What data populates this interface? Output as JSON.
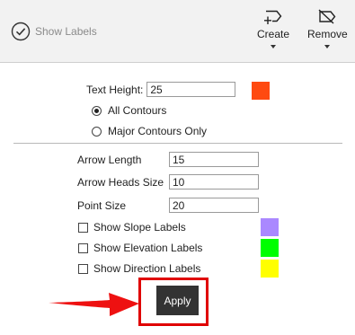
{
  "toolbar": {
    "show_labels": "Show Labels",
    "create": {
      "label": "Create",
      "icon": "create-point-icon"
    },
    "remove": {
      "label": "Remove",
      "icon": "remove-label-icon"
    }
  },
  "text_height": {
    "label": "Text Height:",
    "value": "25",
    "color": "#ff4a10"
  },
  "contour_options": [
    {
      "label": "All Contours",
      "selected": true
    },
    {
      "label": "Major Contours Only",
      "selected": false
    }
  ],
  "arrow_length": {
    "label": "Arrow Length",
    "value": "15"
  },
  "arrow_heads_size": {
    "label": "Arrow Heads Size",
    "value": "10"
  },
  "point_size": {
    "label": "Point Size",
    "value": "20"
  },
  "label_toggles": [
    {
      "label": "Show Slope Labels",
      "checked": false,
      "color": "#aa88ff"
    },
    {
      "label": "Show Elevation Labels",
      "checked": false,
      "color": "#00ff00"
    },
    {
      "label": "Show Direction Labels",
      "checked": false,
      "color": "#ffff00"
    }
  ],
  "apply_label": "Apply",
  "annotation_color": "#e00000"
}
